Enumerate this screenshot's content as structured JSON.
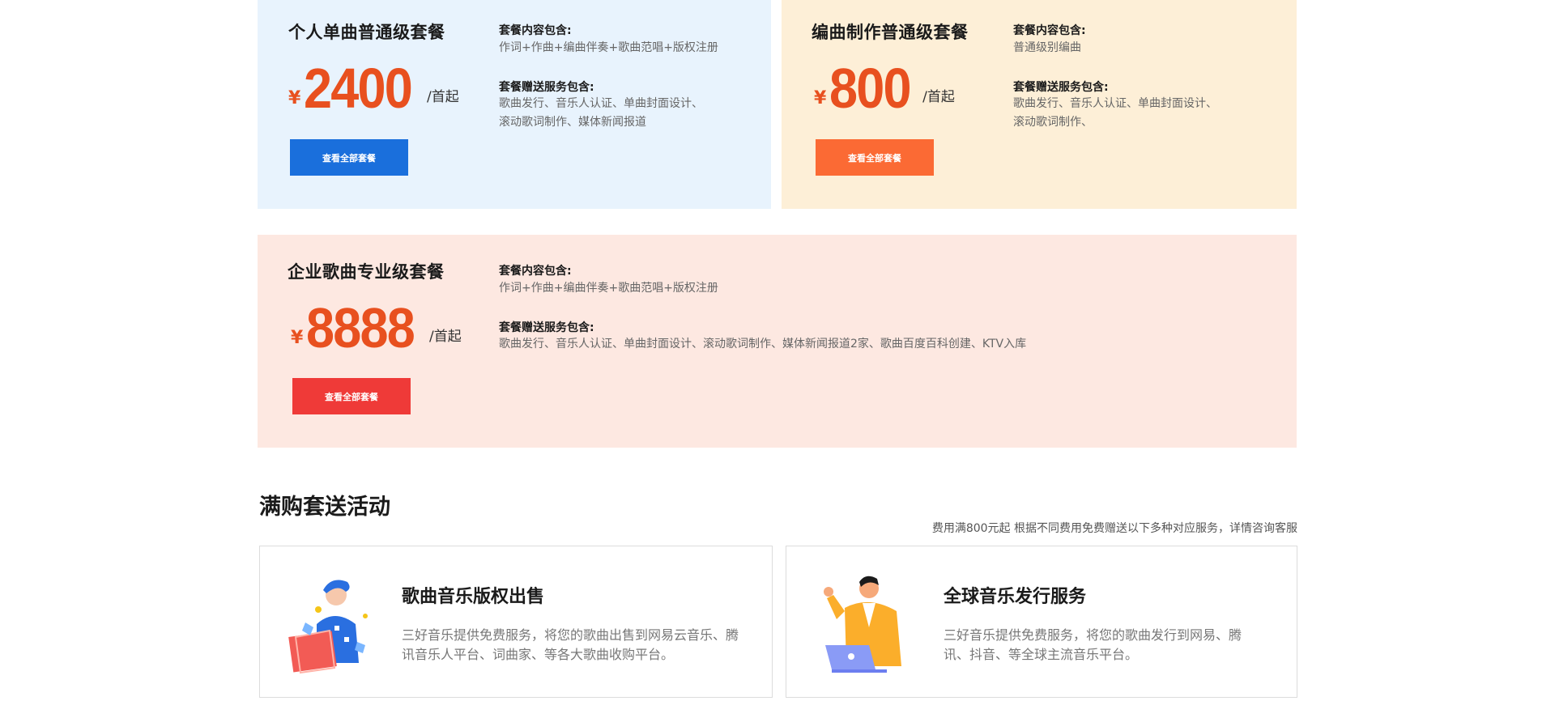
{
  "packages": [
    {
      "title": "个人单曲普通级套餐",
      "currency": "¥",
      "price": "2400",
      "unit": "/首起",
      "content_label": "套餐内容包含:",
      "content_text": "作词+作曲+编曲伴奏+歌曲范唱+版权注册",
      "gift_label": "套餐赠送服务包含:",
      "gift_lines": [
        "歌曲发行、音乐人认证、单曲封面设计、",
        "滚动歌词制作、媒体新闻报道"
      ],
      "button_label": "查看全部套餐",
      "bg_color": "#e8f3fd",
      "button_color": "#1a6fdc",
      "price_color": "#e8501f"
    },
    {
      "title": "编曲制作普通级套餐",
      "currency": "¥",
      "price": "800",
      "unit": "/首起",
      "content_label": "套餐内容包含:",
      "content_text": "普通级别编曲",
      "gift_label": "套餐赠送服务包含:",
      "gift_lines": [
        "歌曲发行、音乐人认证、单曲封面设计、",
        "滚动歌词制作、"
      ],
      "button_label": "查看全部套餐",
      "bg_color": "#fdefd7",
      "button_color": "#fb6a34",
      "price_color": "#e8501f"
    },
    {
      "title": "企业歌曲专业级套餐",
      "currency": "¥",
      "price": "8888",
      "unit": "/首起",
      "content_label": "套餐内容包含:",
      "content_text": "作词+作曲+编曲伴奏+歌曲范唱+版权注册",
      "gift_label": "套餐赠送服务包含:",
      "gift_lines": [
        "歌曲发行、音乐人认证、单曲封面设计、滚动歌词制作、媒体新闻报道2家、歌曲百度百科创建、KTV入库"
      ],
      "button_label": "查看全部套餐",
      "bg_color": "#fde8e1",
      "button_color": "#ef3a38",
      "price_color": "#e8501f"
    }
  ],
  "promo": {
    "title": "满购套送活动",
    "subtitle": "费用满800元起 根据不同费用免费赠送以下多种对应服务，详情咨询客服"
  },
  "services": [
    {
      "title": "歌曲音乐版权出售",
      "description": "三好音乐提供免费服务，将您的歌曲出售到网易云音乐、腾讯音乐人平台、词曲家、等各大歌曲收购平台。",
      "icon": "music-copyright-illustration"
    },
    {
      "title": "全球音乐发行服务",
      "description": "三好音乐提供免费服务，将您的歌曲发行到网易、腾讯、抖音、等全球主流音乐平台。",
      "icon": "global-release-illustration"
    }
  ]
}
